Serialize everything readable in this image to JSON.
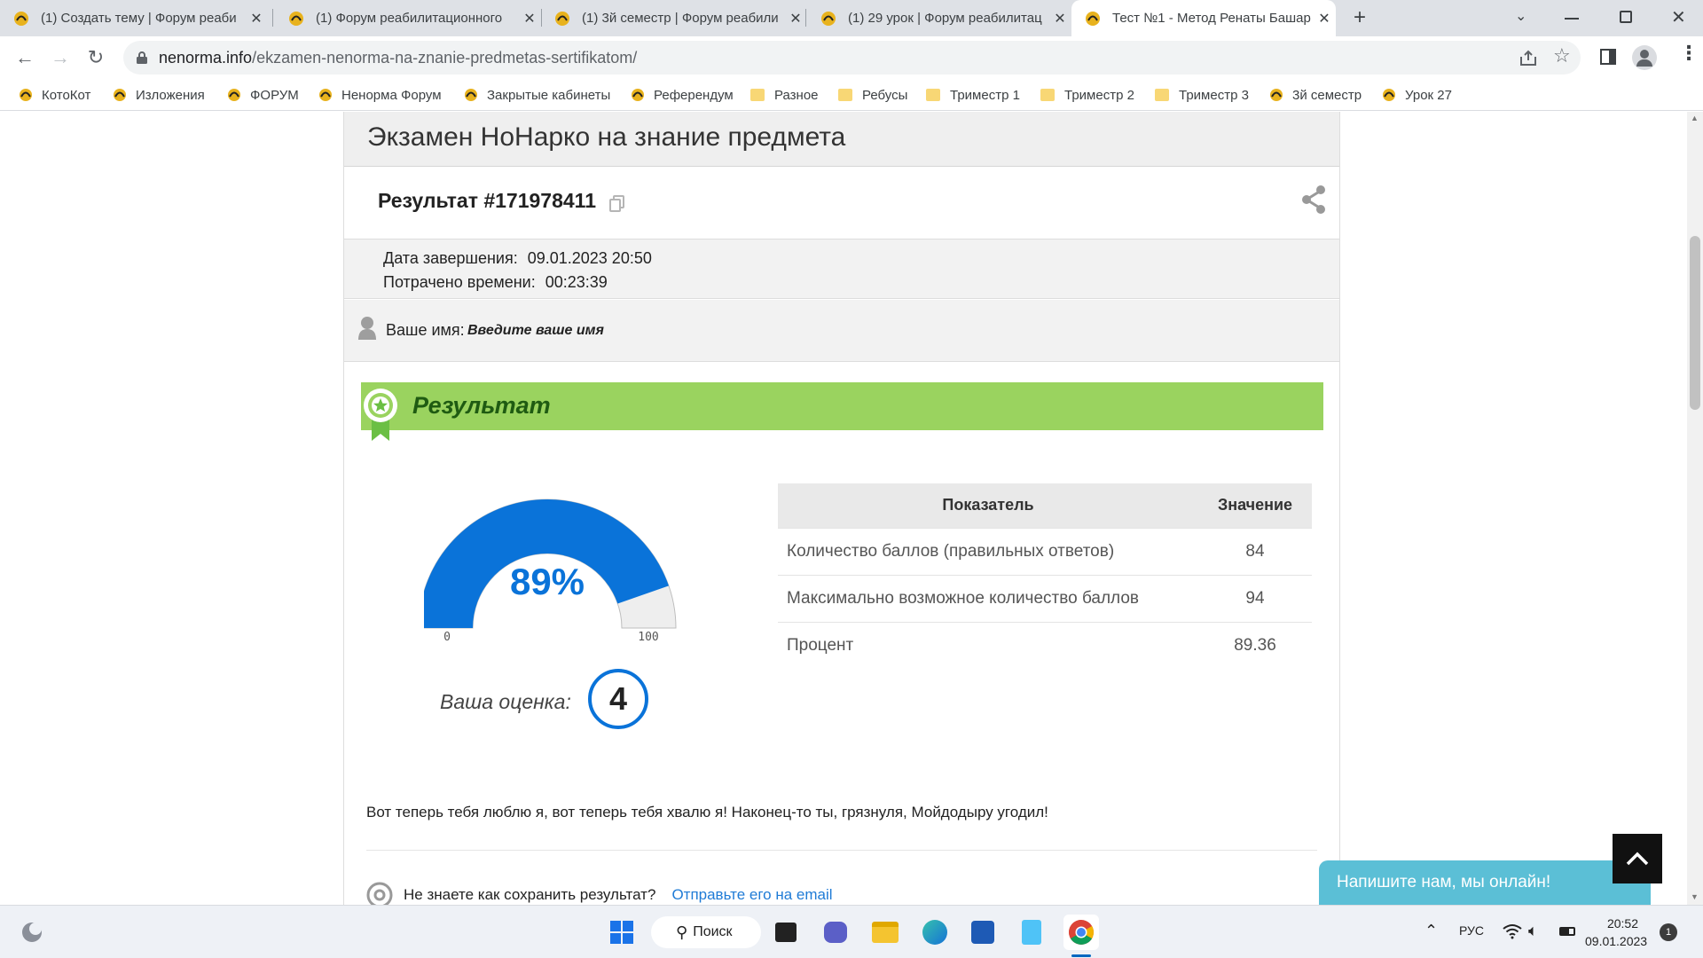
{
  "browser": {
    "tabs": [
      {
        "title": "(1) Создать тему | Форум реаби",
        "active": false
      },
      {
        "title": "(1) Форум реабилитационного",
        "active": false
      },
      {
        "title": "(1) 3й семестр | Форум реабили",
        "active": false
      },
      {
        "title": "(1) 29 урок | Форум реабилитац",
        "active": false
      },
      {
        "title": "Тест №1 - Метод Ренаты Башар",
        "active": true
      }
    ],
    "url_domain": "nenorma.info",
    "url_path": "/ekzamen-nenorma-na-znanie-predmetas-sertifikatom/",
    "bookmarks": [
      {
        "label": "КотоКот",
        "icon": "site"
      },
      {
        "label": "Изложения",
        "icon": "site"
      },
      {
        "label": "ФОРУМ",
        "icon": "site"
      },
      {
        "label": "Ненорма Форум",
        "icon": "site"
      },
      {
        "label": "Закрытые кабинеты",
        "icon": "site"
      },
      {
        "label": "Референдум",
        "icon": "site"
      },
      {
        "label": "Разное",
        "icon": "folder"
      },
      {
        "label": "Ребусы",
        "icon": "folder"
      },
      {
        "label": "Триместр 1",
        "icon": "folder"
      },
      {
        "label": "Триместр 2",
        "icon": "folder"
      },
      {
        "label": "Триместр 3",
        "icon": "folder"
      },
      {
        "label": "3й семестр",
        "icon": "site"
      },
      {
        "label": "Урок 27",
        "icon": "site"
      }
    ]
  },
  "page": {
    "exam_title": "Экзамен НоНарко на знание предмета",
    "result_title": "Результат #171978411",
    "finish_label": "Дата завершения:",
    "finish_value": "09.01.2023 20:50",
    "spent_label": "Потрачено времени:",
    "spent_value": "00:23:39",
    "name_label": "Ваше имя:",
    "name_value": "Введите ваше имя",
    "banner_label": "Результат",
    "gauge": {
      "percent_label": "89%",
      "fraction": 0.8936,
      "min": "0",
      "max": "100"
    },
    "grade_label": "Ваша оценка:",
    "grade_value": "4",
    "stats_header": {
      "metric": "Показатель",
      "value": "Значение"
    },
    "stats_rows": [
      {
        "metric": "Количество баллов (правильных ответов)",
        "value": "84"
      },
      {
        "metric": "Максимально возможное количество баллов",
        "value": "94"
      },
      {
        "metric": "Процент",
        "value": "89.36"
      }
    ],
    "praise_text": "Вот теперь тебя люблю я, вот теперь тебя хвалю я! Наконец-то ты, грязнуля, Мойдодыру угодил!",
    "save_question": "Не знаете как сохранить результат?",
    "save_link": "Отправьте его на email"
  },
  "chat_widget": {
    "label": "Напишите нам, мы онлайн!"
  },
  "taskbar": {
    "search_label": "Поиск",
    "lang": "РУС",
    "time": "20:52",
    "date": "09.01.2023",
    "notifications": "1"
  },
  "colors": {
    "accent_blue": "#0a73d9",
    "banner_green": "#9ad35f",
    "gauge_rest": "#eeeeee",
    "chat_teal": "#5bbfd6"
  }
}
